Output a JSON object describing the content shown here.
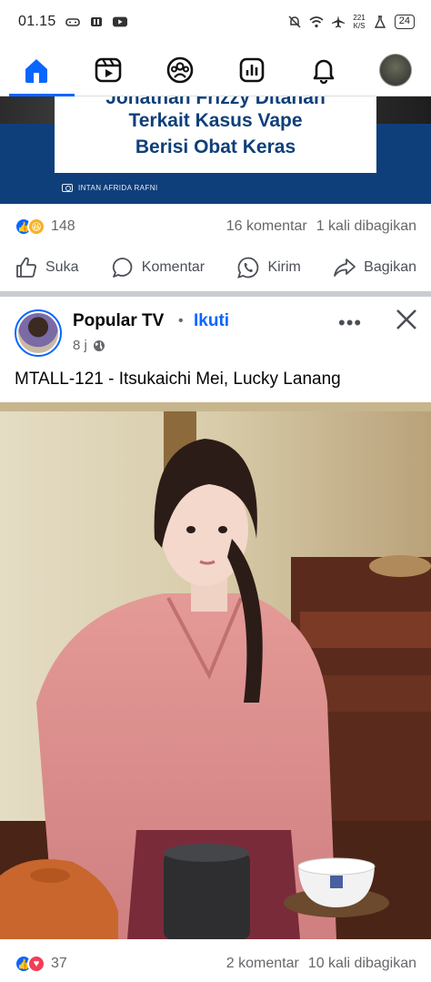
{
  "status_bar": {
    "time": "01.15",
    "net_speed_value": "221",
    "net_speed_unit": "K/S",
    "battery": "24"
  },
  "nav": {
    "items": [
      {
        "name": "home",
        "active": true
      },
      {
        "name": "video"
      },
      {
        "name": "groups"
      },
      {
        "name": "dashboard"
      },
      {
        "name": "notifications"
      },
      {
        "name": "profile"
      }
    ],
    "accent": "#0866ff"
  },
  "prev_post": {
    "headline_cut": "Jonathan Frizzy Ditahan",
    "headline_lines": [
      "Terkait Kasus Vape",
      "Berisi Obat Keras"
    ],
    "photo_credit": "INTAN AFRIDA RAFNI",
    "reaction_count": "148",
    "comments": "16 komentar",
    "shares": "1 kali dibagikan"
  },
  "actions": {
    "like": "Suka",
    "comment": "Komentar",
    "send": "Kirim",
    "share": "Bagikan"
  },
  "post": {
    "page_name": "Popular TV",
    "separator": "•",
    "follow": "Ikuti",
    "time": "8 j",
    "caption": "MTALL-121 - Itsukaichi Mei, Lucky Lanang",
    "more": "•••",
    "reaction_count": "37",
    "comments": "2 komentar",
    "shares": "10 kali dibagikan"
  }
}
